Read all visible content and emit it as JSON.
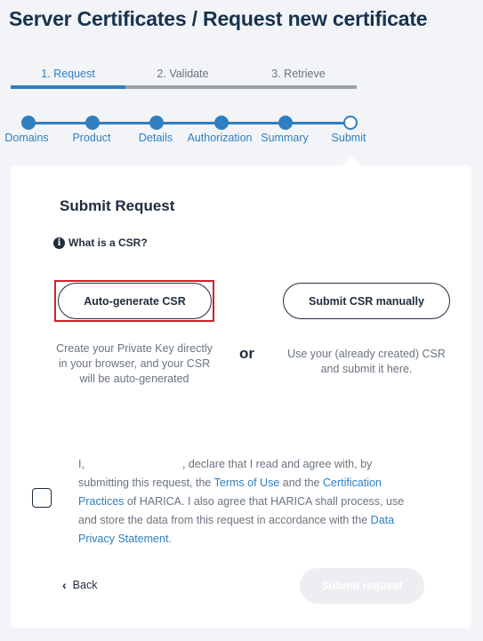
{
  "page": {
    "title": "Server Certificates / Request new certificate"
  },
  "tabs": [
    {
      "label": "1. Request"
    },
    {
      "label": "2. Validate"
    },
    {
      "label": "3. Retrieve"
    }
  ],
  "stepper": {
    "steps": [
      {
        "label": "Domains",
        "state": "done"
      },
      {
        "label": "Product",
        "state": "done"
      },
      {
        "label": "Details",
        "state": "done"
      },
      {
        "label": "Authorization",
        "state": "done"
      },
      {
        "label": "Summary",
        "state": "done"
      },
      {
        "label": "Submit",
        "state": "current"
      }
    ]
  },
  "card": {
    "heading": "Submit Request",
    "info_link": "What is a CSR?",
    "info_icon": "info-circle-icon",
    "auto_button": "Auto-generate CSR",
    "manual_button": "Submit CSR manually",
    "auto_desc": "Create your Private Key directly in your browser, and your CSR will be auto-generated",
    "or_label": "or",
    "manual_desc": "Use your (already created) CSR and submit it here."
  },
  "agreement": {
    "part1": "I,",
    "part2": ", declare that I read and agree with, by submitting this request, the",
    "terms_link": "Terms of Use",
    "part3": "and the",
    "cp_link": "Certification Practices",
    "part4": "of HARICA. I also agree that HARICA shall process, use and store the data from this request in accordance with the",
    "privacy_link": "Data Privacy Statement",
    "part5": "."
  },
  "footer": {
    "back_label": "Back",
    "back_icon": "chevron-left-icon",
    "submit_label": "Submit request"
  },
  "colors": {
    "accent": "#2f7fc1",
    "highlight": "#d61f26",
    "dark_text": "#1f2d3d",
    "muted_text": "#6b7480"
  }
}
